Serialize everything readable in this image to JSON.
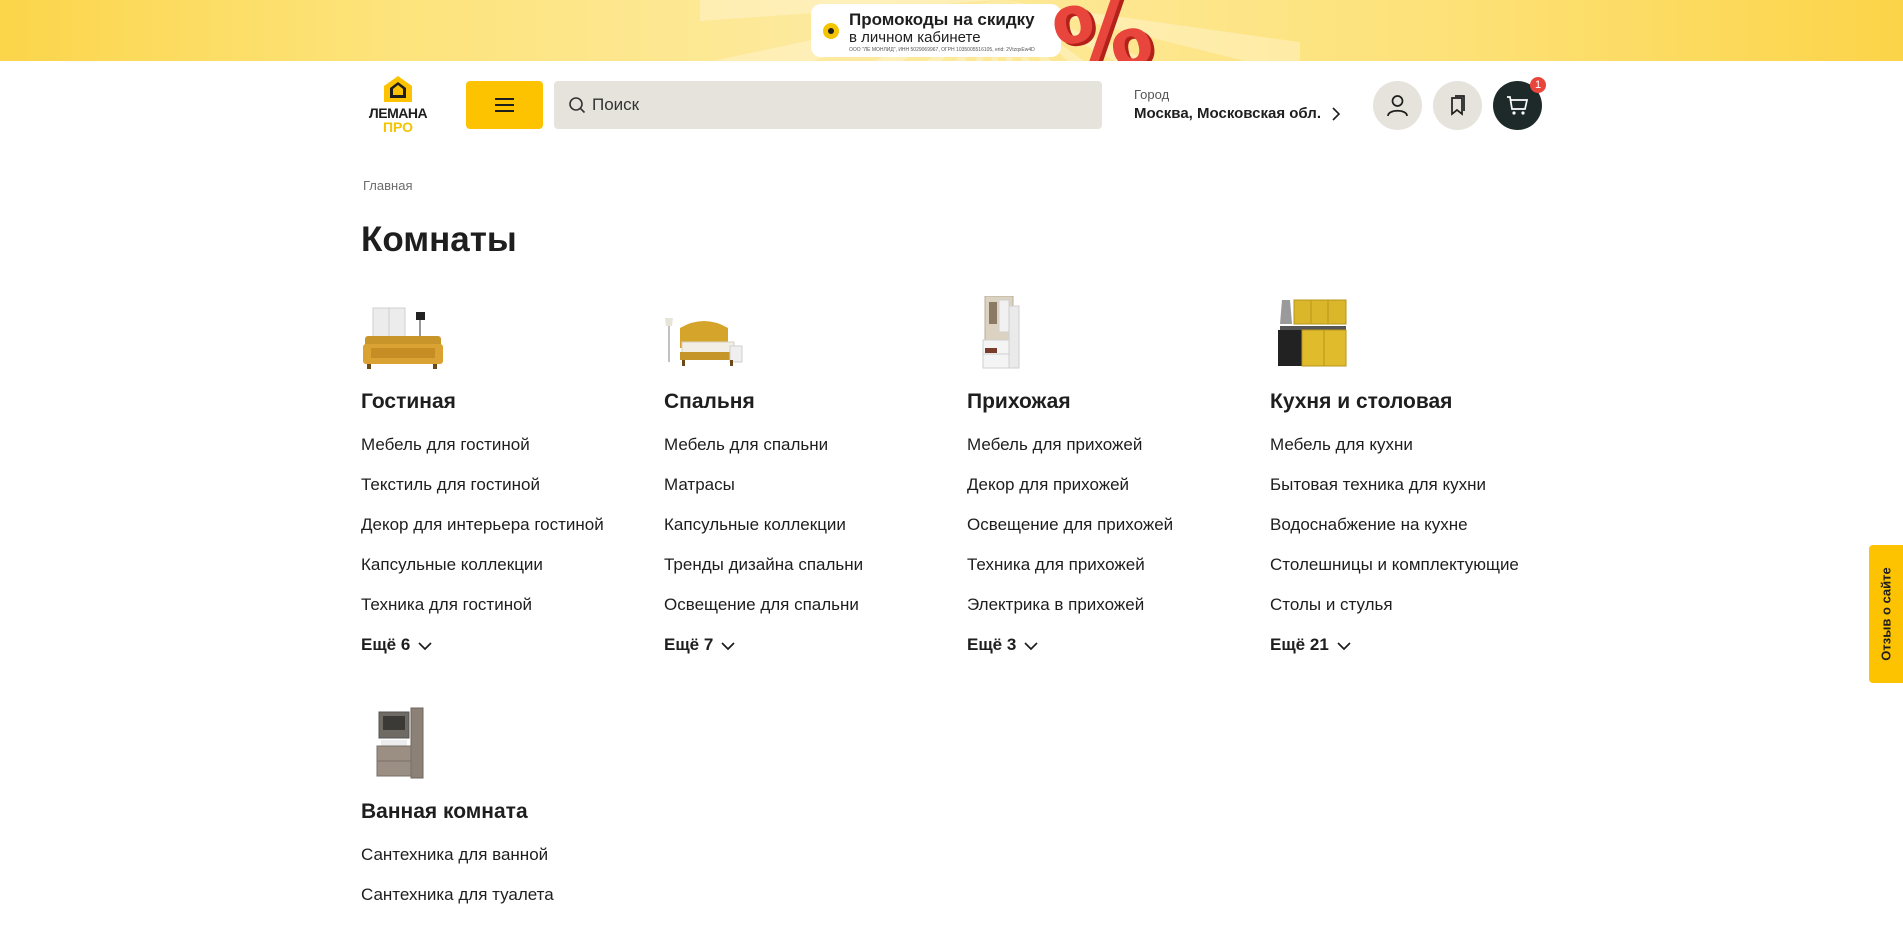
{
  "promo": {
    "title": "Промокоды на скидку",
    "subtitle": "в личном кабинете",
    "legal": "ООО \"ЛЕ МОНЛИД\", ИНН 5029069967, ОГРН 1035005516105, erid: 2VtzqxEw4D",
    "graphic": "%"
  },
  "header": {
    "logo_top": "ЛЕМАНА",
    "logo_bottom": "ПРО",
    "search_placeholder": "Поиск",
    "city_label": "Город",
    "city_value": "Москва, Московская обл.",
    "cart_count": "1"
  },
  "breadcrumb": "Главная",
  "page_title": "Комнаты",
  "categories": [
    {
      "title": "Гостиная",
      "links": [
        "Мебель для гостиной",
        "Текстиль для гостиной",
        "Декор для интерьера гостиной",
        "Капсульные коллекции",
        "Техника для гостиной"
      ],
      "more": "Ещё 6"
    },
    {
      "title": "Спальня",
      "links": [
        "Мебель для спальни",
        "Матрасы",
        "Капсульные коллекции",
        "Тренды дизайна спальни",
        "Освещение для спальни"
      ],
      "more": "Ещё 7"
    },
    {
      "title": "Прихожая",
      "links": [
        "Мебель для прихожей",
        "Декор для прихожей",
        "Освещение для прихожей",
        "Техника для прихожей",
        "Электрика в прихожей"
      ],
      "more": "Ещё 3"
    },
    {
      "title": "Кухня и столовая",
      "links": [
        "Мебель для кухни",
        "Бытовая техника для кухни",
        "Водоснабжение на кухне",
        "Столешницы и комплектующие",
        "Столы и стулья"
      ],
      "more": "Ещё 21"
    },
    {
      "title": "Ванная комната",
      "links": [
        "Сантехника для ванной",
        "Сантехника для туалета"
      ]
    }
  ],
  "feedback": "Отзыв о сайте",
  "colors": {
    "accent": "#fdc300",
    "promo_red": "#e8453c",
    "cart_dark": "#1e2a2a",
    "search_bg": "#e6e3dc"
  },
  "icons": [
    "search-icon",
    "menu-icon",
    "user-icon",
    "bookmark-icon",
    "cart-icon",
    "chevron-right-icon",
    "chevron-down-icon"
  ]
}
